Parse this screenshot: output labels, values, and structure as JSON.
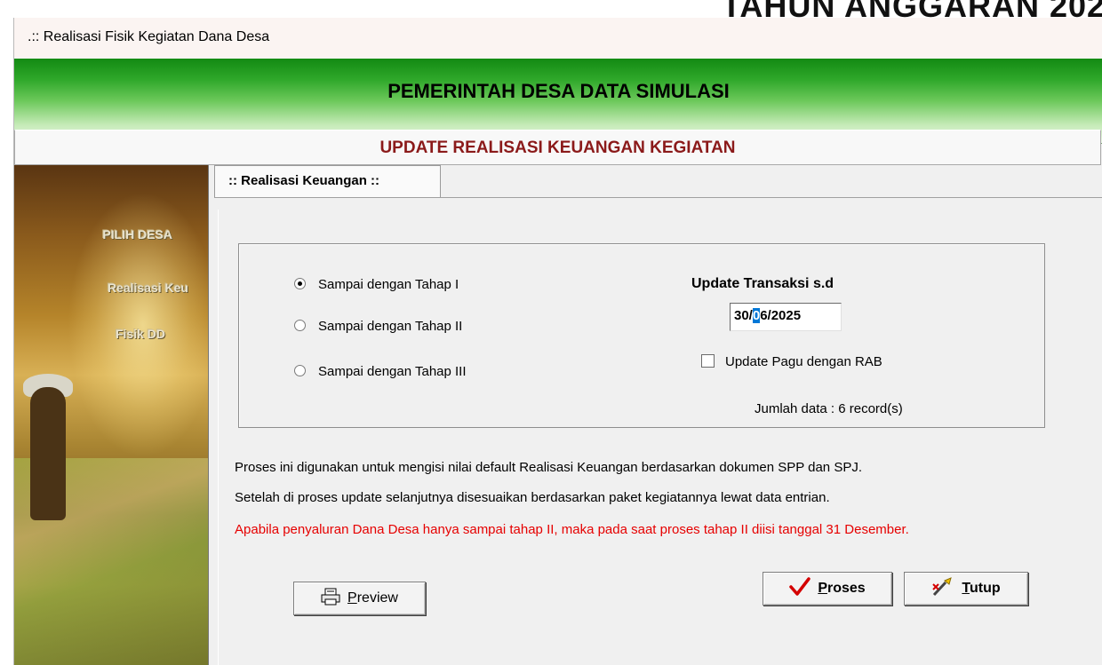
{
  "background_title": "TAHUN ANGGARAN 202",
  "window": {
    "title": ".:: Realisasi Fisik Kegiatan Dana Desa"
  },
  "header": {
    "main": "PEMERINTAH DESA DATA SIMULASI",
    "sub": "UPDATE REALISASI KEUANGAN KEGIATAN"
  },
  "sidebar": {
    "items": [
      {
        "label": "PILIH DESA"
      },
      {
        "label": "Realisasi Keu"
      },
      {
        "label": "Fisik DD"
      }
    ]
  },
  "tabs": [
    {
      "label": ":: Realisasi Keuangan ::",
      "active": true
    }
  ],
  "options": {
    "radios": [
      {
        "label": "Sampai dengan Tahap I",
        "checked": true
      },
      {
        "label": "Sampai dengan Tahap II",
        "checked": false
      },
      {
        "label": "Sampai dengan Tahap III",
        "checked": false
      }
    ],
    "update_title": "Update Transaksi s.d",
    "date": {
      "before": "30/",
      "selected": "0",
      "after": "6/2025"
    },
    "checkbox_label": "Update Pagu dengan RAB",
    "checkbox_checked": false,
    "jumlah": "Jumlah data : 6 record(s)"
  },
  "info": {
    "line1": "Proses ini digunakan untuk mengisi nilai default Realisasi Keuangan berdasarkan dokumen SPP dan SPJ.",
    "line2": "Setelah di proses update selanjutnya disesuaikan berdasarkan paket kegiatannya lewat data entrian.",
    "warning": "Apabila penyaluran Dana Desa hanya sampai tahap II, maka pada saat proses tahap II diisi tanggal 31 Desember."
  },
  "buttons": {
    "preview": {
      "mnemonic": "P",
      "rest": "review"
    },
    "proses": {
      "mnemonic": "P",
      "rest": "roses"
    },
    "tutup": {
      "mnemonic": "T",
      "rest": "utup"
    }
  },
  "colors": {
    "warning": "#e60000",
    "subheader_text": "#8b1a1a",
    "check_mark": "#d40000"
  }
}
